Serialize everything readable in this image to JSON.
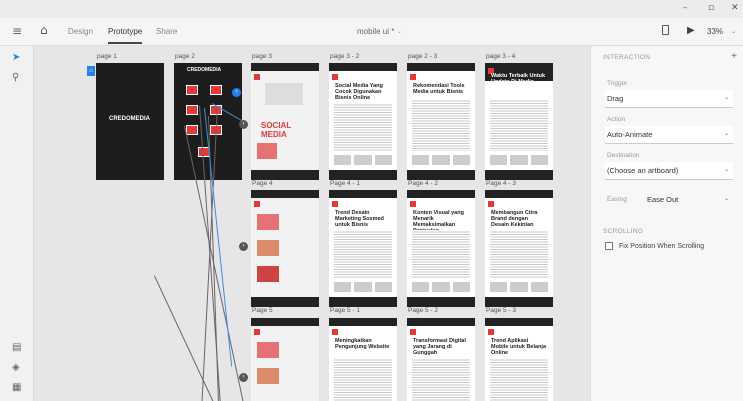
{
  "window": {
    "minimize": "–",
    "restore": "▫",
    "close": "✕"
  },
  "toolbar": {
    "tabs": [
      "Design",
      "Prototype",
      "Share"
    ],
    "doc_title": "mobile ui *",
    "zoom": "33%"
  },
  "artboards": {
    "top": [
      "page 1",
      "page 2",
      "page 3",
      "page 3 - 2",
      "page 2 - 3",
      "page 3 - 4"
    ],
    "row1_bottom": [
      "Page 4",
      "Page 4 - 1",
      "Page 4 - 2",
      "Page 4 - 3"
    ],
    "row2_bottom": [
      "Page 5",
      "Page 5 - 1",
      "Page 5 - 2",
      "Page 5 - 3"
    ],
    "brand": "CREDOMEDIA",
    "headlines_row1": [
      "Social Media Yang Cocok Digunakan Bisnis Online",
      "Rekomendasi Tools Media untuk Bisnis",
      "Waktu Terbaik Untuk Update Di Media Sosial"
    ],
    "headlines_row2": [
      "Trend Desain Marketing Sosmed untuk Bisnis",
      "Konten Visual yang Menarik Memaksimalkan Penjualan",
      "Membangun Citra Brand dengan Desain Kekinian"
    ],
    "headlines_row3": [
      "Meningkatkan Pengunjung Website",
      "Transformasi Digital yang Jarang di Gunggah",
      "Trend Aplikasi Mobile untuk Belanja Online"
    ],
    "social_text": "SOCIAL MEDIA"
  },
  "panel": {
    "section_interaction": "INTERACTION",
    "trigger_label": "Trigger",
    "trigger_value": "Drag",
    "action_label": "Action",
    "action_value": "Auto-Animate",
    "destination_label": "Destination",
    "destination_value": "(Choose an artboard)",
    "easing_label": "Easing",
    "easing_value": "Ease Out",
    "section_scrolling": "SCROLLING",
    "fix_position_label": "Fix Position When Scrolling"
  },
  "colors": {
    "accent": "#e23a3a",
    "wire": "#3b8fd9",
    "dark": "#1d1d1d"
  }
}
